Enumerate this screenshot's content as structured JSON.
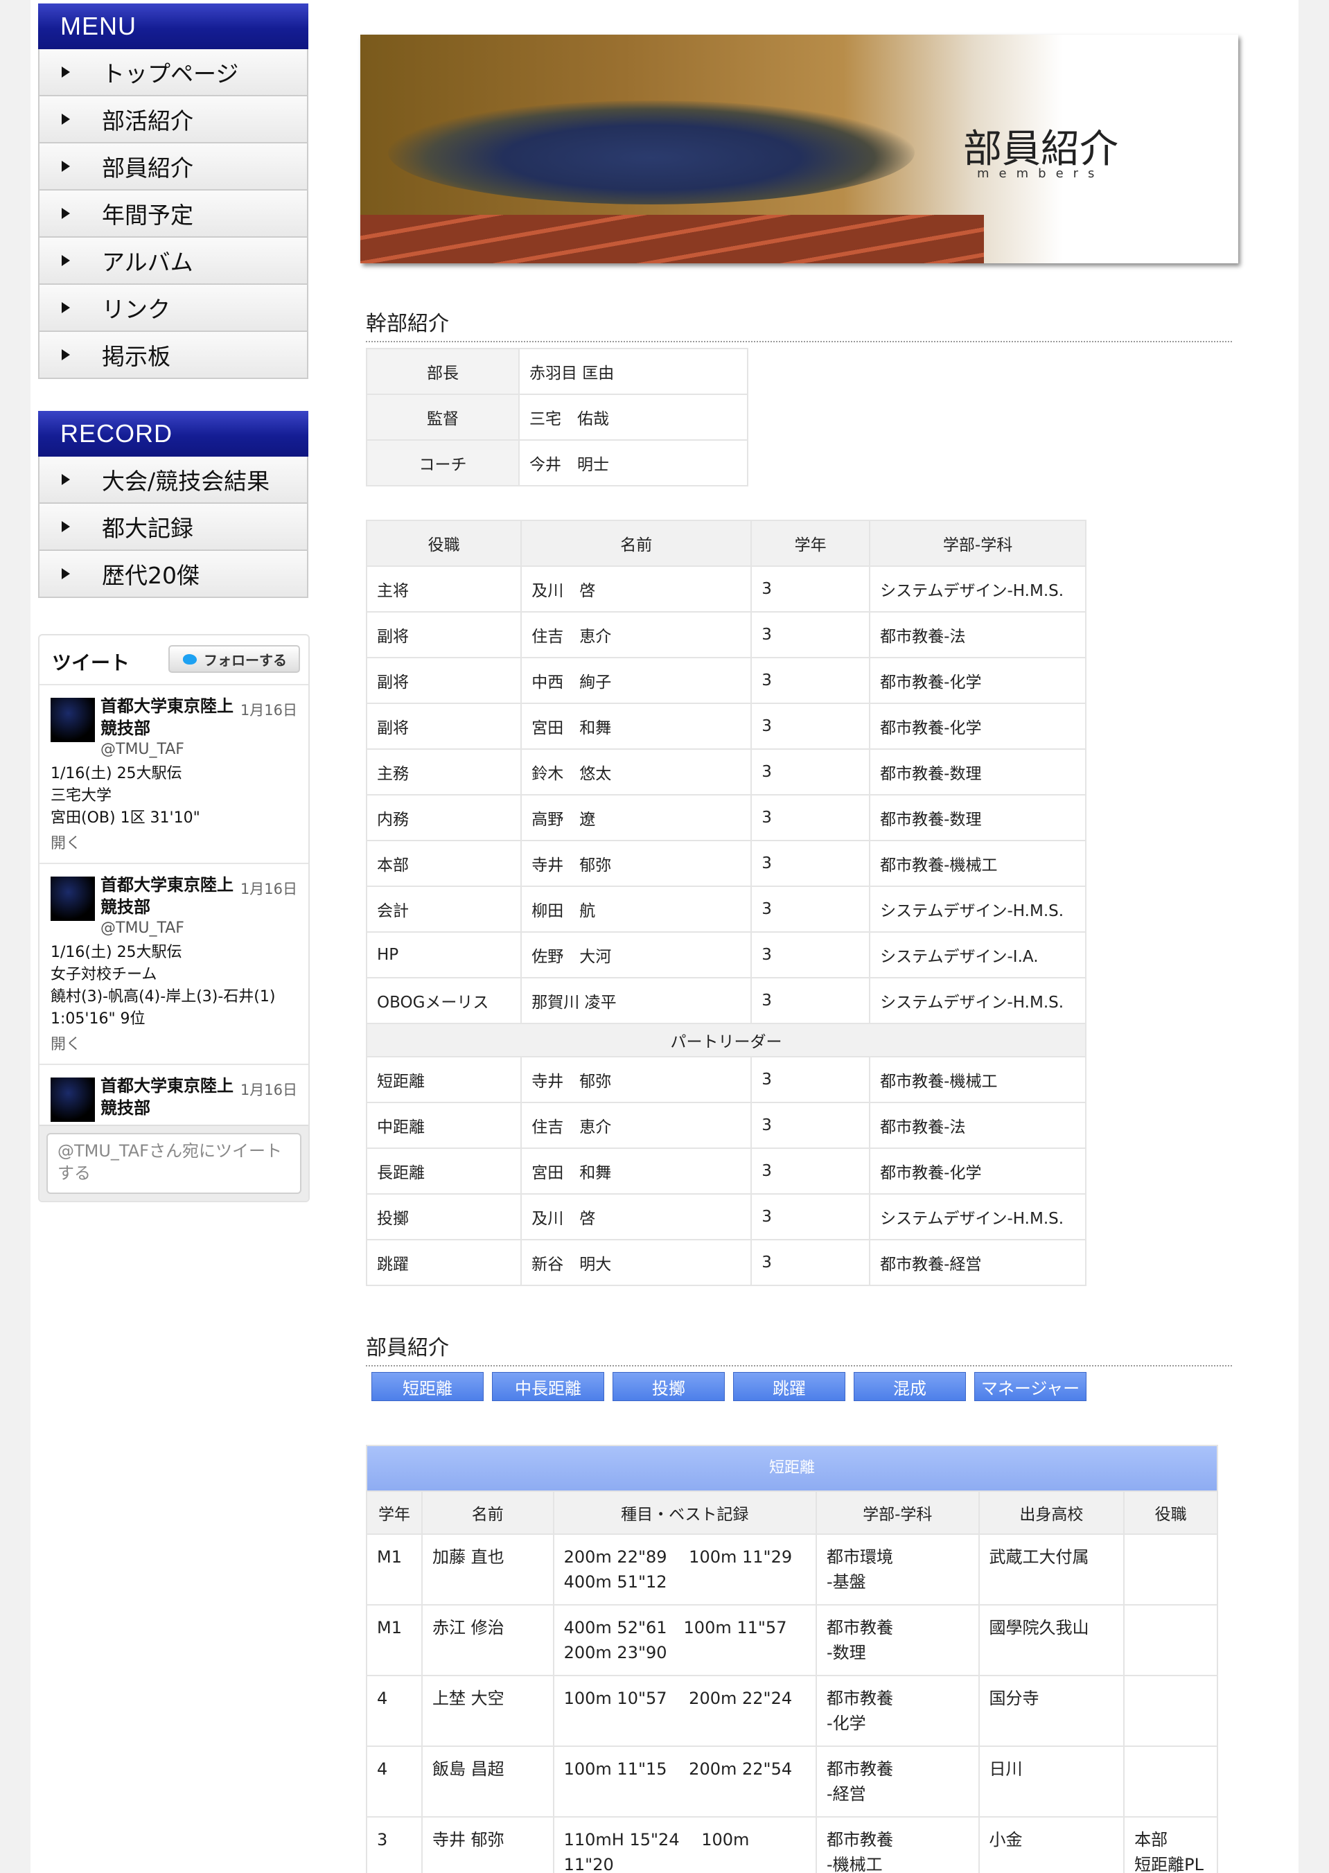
{
  "sidebar": {
    "menu_title": "MENU",
    "menu_items": [
      "トップページ",
      "部活紹介",
      "部員紹介",
      "年間予定",
      "アルバム",
      "リンク",
      "掲示板"
    ],
    "record_title": "RECORD",
    "record_items": [
      "大会/競技会結果",
      "都大記録",
      "歴代20傑"
    ]
  },
  "twitter": {
    "title": "ツイート",
    "follow_label": "フォローする",
    "tweets": [
      {
        "name": "首都大学東京陸上競技部",
        "handle": "@TMU_TAF",
        "date": "1月16日",
        "text": "1/16(土) 25大駅伝\n三宅大学\n宮田(OB) 1区 31'10\"",
        "open": "開く"
      },
      {
        "name": "首都大学東京陸上競技部",
        "handle": "@TMU_TAF",
        "date": "1月16日",
        "text": "1/16(土) 25大駅伝\n女子対校チーム\n饒村(3)-帆高(4)-岸上(3)-石井(1)\n1:05'16\" 9位",
        "open": "開く"
      },
      {
        "name": "首都大学東京陸上競技部",
        "handle": "",
        "date": "1月16日",
        "text": "",
        "open": ""
      }
    ],
    "compose_placeholder": "@TMU_TAFさん宛にツイートする"
  },
  "banner": {
    "title": "部員紹介",
    "subtitle": "members"
  },
  "executives": {
    "title": "幹部紹介",
    "rows": [
      [
        "部長",
        "赤羽目 匡由"
      ],
      [
        "監督",
        "三宅　佑哉"
      ],
      [
        "コーチ",
        "今井　明士"
      ]
    ]
  },
  "roles": {
    "headers": [
      "役職",
      "名前",
      "学年",
      "学部-学科"
    ],
    "rows": [
      [
        "主将",
        "及川　啓",
        "3",
        "システムデザイン-H.M.S."
      ],
      [
        "副将",
        "住吉　恵介",
        "3",
        "都市教養-法"
      ],
      [
        "副将",
        "中西　絢子",
        "3",
        "都市教養-化学"
      ],
      [
        "副将",
        "宮田　和舞",
        "3",
        "都市教養-化学"
      ],
      [
        "主務",
        "鈴木　悠太",
        "3",
        "都市教養-数理"
      ],
      [
        "内務",
        "高野　遼",
        "3",
        "都市教養-数理"
      ],
      [
        "本部",
        "寺井　郁弥",
        "3",
        "都市教養-機械工"
      ],
      [
        "会計",
        "柳田　航",
        "3",
        "システムデザイン-H.M.S."
      ],
      [
        "HP",
        "佐野　大河",
        "3",
        "システムデザイン-I.A."
      ],
      [
        "OBOGメーリス",
        "那賀川 凌平",
        "3",
        "システムデザイン-H.M.S."
      ]
    ],
    "part_leader_label": "パートリーダー",
    "part_rows": [
      [
        "短距離",
        "寺井　郁弥",
        "3",
        "都市教養-機械工"
      ],
      [
        "中距離",
        "住吉　恵介",
        "3",
        "都市教養-法"
      ],
      [
        "長距離",
        "宮田　和舞",
        "3",
        "都市教養-化学"
      ],
      [
        "投擲",
        "及川　啓",
        "3",
        "システムデザイン-H.M.S."
      ],
      [
        "跳躍",
        "新谷　明大",
        "3",
        "都市教養-経営"
      ]
    ]
  },
  "members_section": {
    "title": "部員紹介",
    "tabs": [
      "短距離",
      "中長距離",
      "投擲",
      "跳躍",
      "混成",
      "マネージャー"
    ],
    "table_caption": "短距離",
    "headers": [
      "学年",
      "名前",
      "種目・ベスト記録",
      "学部-学科",
      "出身高校",
      "役職"
    ],
    "rows": [
      [
        "M1",
        "加藤 直也",
        "200m 22\"89　 100m 11\"29\n400m 51\"12",
        "都市環境\n-基盤",
        "武蔵工大付属",
        ""
      ],
      [
        "M1",
        "赤江 修治",
        "400m 52\"61　100m 11\"57\n200m 23\"90",
        "都市教養\n-数理",
        "國學院久我山",
        ""
      ],
      [
        "4",
        "上埜 大空",
        "100m 10\"57　 200m 22\"24",
        "都市教養\n-化学",
        "国分寺",
        ""
      ],
      [
        "4",
        "飯島 昌超",
        "100m 11\"15　 200m 22\"54",
        "都市教養\n-経営",
        "日川",
        ""
      ],
      [
        "3",
        "寺井 郁弥",
        "110mH 15\"24　 100m\n11\"20",
        "都市教養\n-機械工",
        "小金",
        "本部\n短距離PL"
      ]
    ]
  }
}
